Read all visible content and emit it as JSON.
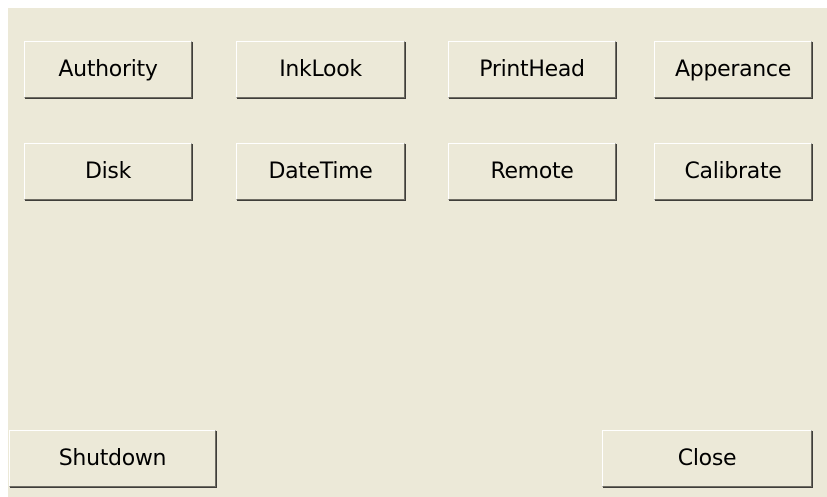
{
  "buttons": {
    "authority": "Authority",
    "inklook": "InkLook",
    "printhead": "PrintHead",
    "apperance": "Apperance",
    "disk": "Disk",
    "datetime": "DateTime",
    "remote": "Remote",
    "calibrate": "Calibrate",
    "shutdown": "Shutdown",
    "close": "Close"
  }
}
